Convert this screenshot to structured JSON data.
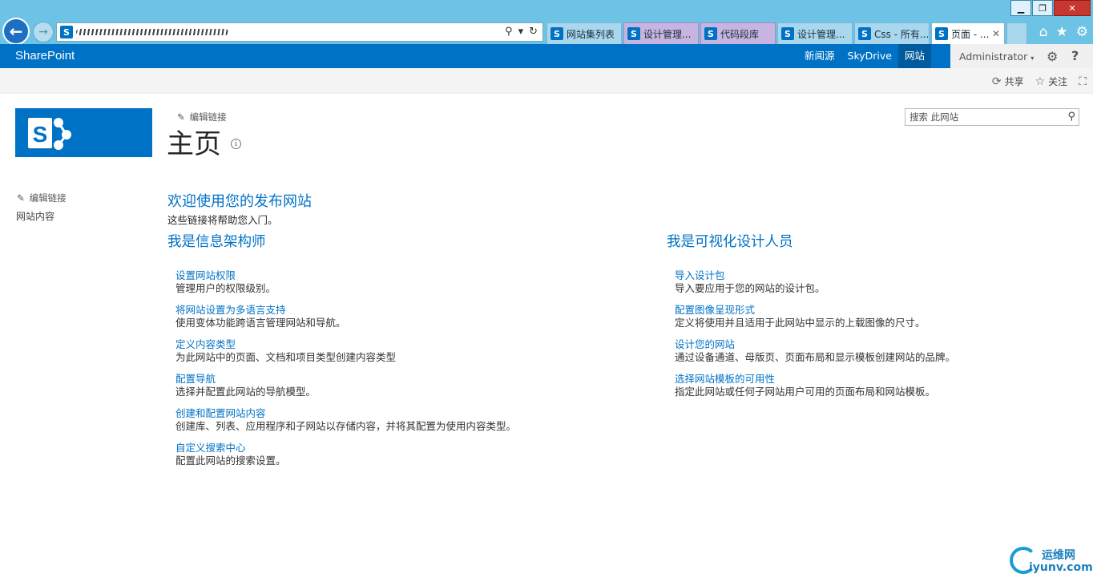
{
  "colors": {
    "brand_blue": "#0072c6",
    "chrome_blue": "#6cc3e6",
    "ribbon_gray": "#f4f4f4",
    "close_red": "#c8372f"
  },
  "window": {
    "min_icon": "minimize-icon",
    "max_icon": "restore-icon",
    "close_icon": "close-icon",
    "min_glyph": "▁",
    "max_glyph": "❐",
    "close_glyph": "✕"
  },
  "browser": {
    "back_glyph": "←",
    "forward_glyph": "→",
    "favicon_letter": "S",
    "address_icons": [
      "⚲",
      "▾",
      "↻"
    ],
    "tabs": [
      {
        "label": "网站集列表",
        "style": "blue"
      },
      {
        "label": "设计管理...",
        "style": "purple"
      },
      {
        "label": "代码段库",
        "style": "purple"
      },
      {
        "label": "设计管理...",
        "style": "blue"
      },
      {
        "label": "Css - 所有...",
        "style": "blue"
      },
      {
        "label": "页面 - ...",
        "style": "active",
        "close": "✕"
      }
    ],
    "right_icons": [
      "⌂",
      "★",
      "⚙"
    ]
  },
  "suite": {
    "brand": "SharePoint",
    "links": [
      "新闻源",
      "SkyDrive",
      "网站"
    ],
    "active_link": "网站",
    "user": "Administrator",
    "user_caret": "▾",
    "gear_glyph": "⚙",
    "help_glyph": "?"
  },
  "ribbon": {
    "share": "共享",
    "follow": "关注",
    "share_glyph": "⟳",
    "follow_glyph": "☆",
    "focus_glyph": "⛶"
  },
  "header": {
    "edit_links": "编辑链接",
    "pencil_glyph": "✎",
    "page_title": "主页",
    "info_glyph": "i",
    "search_placeholder": "搜索 此网站",
    "search_glyph": "⚲"
  },
  "left_nav": {
    "edit_links": "编辑链接",
    "site_contents": "网站内容"
  },
  "main": {
    "welcome_title": "欢迎使用您的发布网站",
    "welcome_subtitle": "这些链接将帮助您入门。",
    "columns": [
      {
        "title": "我是信息架构师",
        "items": [
          {
            "title": "设置网站权限",
            "desc": "管理用户的权限级别。"
          },
          {
            "title": "将网站设置为多语言支持",
            "desc": "使用变体功能跨语言管理网站和导航。"
          },
          {
            "title": "定义内容类型",
            "desc": "为此网站中的页面、文档和项目类型创建内容类型"
          },
          {
            "title": "配置导航",
            "desc": "选择并配置此网站的导航模型。"
          },
          {
            "title": "创建和配置网站内容",
            "desc": "创建库、列表、应用程序和子网站以存储内容，并将其配置为使用内容类型。"
          },
          {
            "title": "自定义搜索中心",
            "desc": "配置此网站的搜索设置。"
          }
        ]
      },
      {
        "title": "我是可视化设计人员",
        "items": [
          {
            "title": "导入设计包",
            "desc": "导入要应用于您的网站的设计包。"
          },
          {
            "title": "配置图像呈现形式",
            "desc": "定义将使用并且适用于此网站中显示的上载图像的尺寸。"
          },
          {
            "title": "设计您的网站",
            "desc": "通过设备通道、母版页、页面布局和显示模板创建网站的品牌。"
          },
          {
            "title": "选择网站模板的可用性",
            "desc": "指定此网站或任何子网站用户可用的页面布局和网站模板。"
          }
        ]
      }
    ]
  },
  "watermark": {
    "cn": "运维网",
    "en": "iyunv.com"
  }
}
